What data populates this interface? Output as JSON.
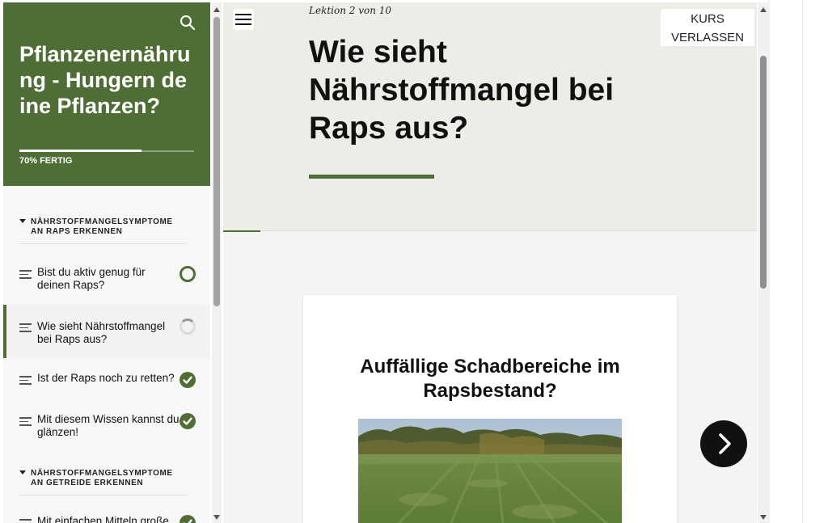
{
  "course": {
    "title": "Pflanzenernährung - Hungern deine Pflanzen?",
    "progress_label": "70% FERTIG",
    "progress_fraction": 0.7
  },
  "sidebar": {
    "sections": [
      {
        "title": "NÄHRSTOFFMANGELSYMPTOME AN RAPS ERKENNEN",
        "lessons": [
          {
            "label": "Bist du aktiv genug für deinen Raps?",
            "status": "partial"
          },
          {
            "label": "Wie sieht Nährstoffmangel bei Raps aus?",
            "status": "started",
            "active": true
          },
          {
            "label": "Ist der Raps noch zu retten?",
            "status": "done"
          },
          {
            "label": "Mit diesem Wissen kannst du glänzen!",
            "status": "done"
          }
        ]
      },
      {
        "title": "NÄHRSTOFFMANGELSYMPTOME AN GETREIDE ERKENNEN",
        "lessons": [
          {
            "label": "Mit einfachen Mitteln große",
            "status": "done"
          }
        ]
      }
    ]
  },
  "lesson": {
    "counter": "Lektion 2 von 10",
    "title": "Wie sieht Nährstoffmangel bei Raps aus?"
  },
  "header": {
    "exit_label": "KURS VERLASSEN"
  },
  "card": {
    "heading": "Auffällige Schadbereiche im Rapsbestand?"
  },
  "colors": {
    "accent": "#4f6e35",
    "hero_bg": "#ebede7",
    "main_bg": "#f4f4f4"
  },
  "icons": {
    "search": "search-icon",
    "menu": "hamburger-menu-icon",
    "next": "chevron-right-icon"
  }
}
